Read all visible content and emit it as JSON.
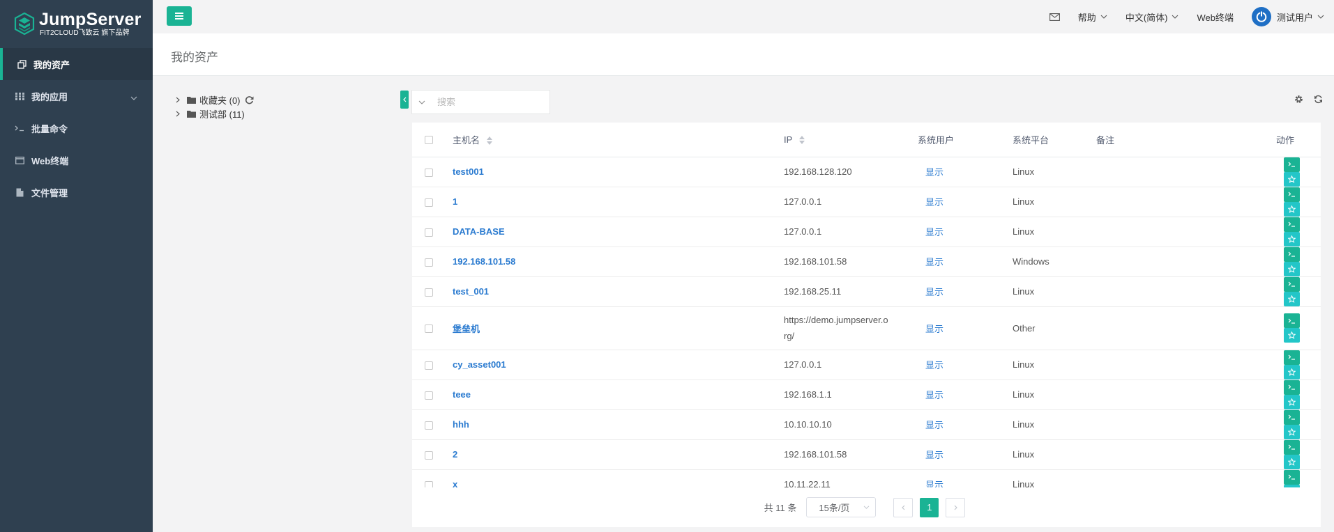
{
  "brand": {
    "title": "JumpServer",
    "subtitle": "FIT2CLOUD飞致云 旗下品牌"
  },
  "sidebar": {
    "items": [
      {
        "label": "我的资产",
        "icon": "assets-icon"
      },
      {
        "label": "我的应用",
        "icon": "grid-icon"
      },
      {
        "label": "批量命令",
        "icon": "terminal-icon"
      },
      {
        "label": "Web终端",
        "icon": "window-icon"
      },
      {
        "label": "文件管理",
        "icon": "file-icon"
      }
    ]
  },
  "header": {
    "help": "帮助",
    "language": "中文(简体)",
    "web_terminal": "Web终端",
    "user": "测试用户"
  },
  "page": {
    "title": "我的资产"
  },
  "tree": {
    "nodes": [
      {
        "label": "收藏夹 (0)"
      },
      {
        "label": "测试部 (11)"
      }
    ]
  },
  "search": {
    "placeholder": "搜索"
  },
  "table": {
    "headers": {
      "hostname": "主机名",
      "ip": "IP",
      "system_user": "系统用户",
      "platform": "系统平台",
      "comment": "备注",
      "actions": "动作"
    },
    "rows": [
      {
        "hostname": "test001",
        "ip": "192.168.128.120",
        "system_user": "显示",
        "platform": "Linux"
      },
      {
        "hostname": "1",
        "ip": "127.0.0.1",
        "system_user": "显示",
        "platform": "Linux"
      },
      {
        "hostname": "DATA-BASE",
        "ip": "127.0.0.1",
        "system_user": "显示",
        "platform": "Linux"
      },
      {
        "hostname": "192.168.101.58",
        "ip": "192.168.101.58",
        "system_user": "显示",
        "platform": "Windows"
      },
      {
        "hostname": "test_001",
        "ip": "192.168.25.11",
        "system_user": "显示",
        "platform": "Linux"
      },
      {
        "hostname": "堡垒机",
        "ip": "https://demo.jumpserver.o",
        "ip_line2": "rg/",
        "system_user": "显示",
        "platform": "Other"
      },
      {
        "hostname": "cy_asset001",
        "ip": "127.0.0.1",
        "system_user": "显示",
        "platform": "Linux"
      },
      {
        "hostname": "teee",
        "ip": "192.168.1.1",
        "system_user": "显示",
        "platform": "Linux"
      },
      {
        "hostname": "hhh",
        "ip": "10.10.10.10",
        "system_user": "显示",
        "platform": "Linux"
      },
      {
        "hostname": "2",
        "ip": "192.168.101.58",
        "system_user": "显示",
        "platform": "Linux"
      },
      {
        "hostname": "x",
        "ip": "10.11.22.11",
        "system_user": "显示",
        "platform": "Linux"
      }
    ]
  },
  "pagination": {
    "total": "共 11 条",
    "page_size": "15条/页",
    "current_page": "1"
  },
  "colors": {
    "accent": "#1ab394",
    "sidebar": "#2f4050",
    "link": "#2b7bd0",
    "star_button": "#23c6c8"
  }
}
